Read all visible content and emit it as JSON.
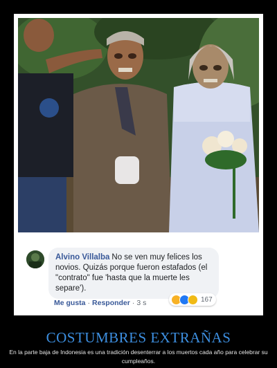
{
  "comment": {
    "author": "Alvino Villalba",
    "text": "No se ven muy felices los novios. Quizás porque fueron estafados (el \"contrato\" fue 'hasta que la muerte les separe').",
    "like_label": "Me gusta",
    "reply_label": "Responder",
    "separator": "·",
    "time": "3 s",
    "reaction_count": "167",
    "reactions": [
      "haha",
      "like",
      "wow"
    ]
  },
  "poster": {
    "title": "COSTUMBRES EXTRAÑAS",
    "caption": "En la parte baja de Indonesia es una tradición desenterrar a los muertos cada año para celebrar su cumpleaños."
  },
  "colors": {
    "background": "#000000",
    "title": "#3d8fe0",
    "author": "#385898",
    "bubble": "#f0f2f5"
  }
}
